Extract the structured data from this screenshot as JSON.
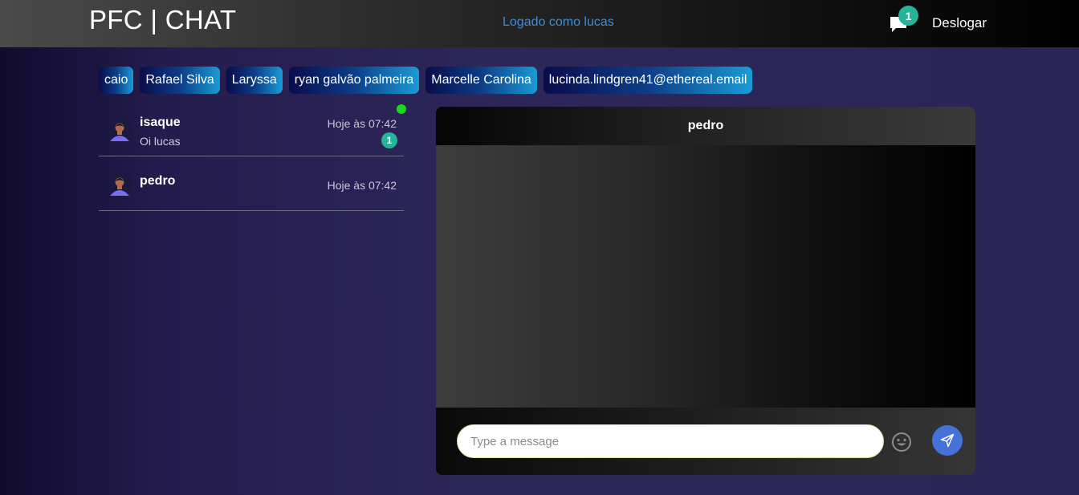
{
  "header": {
    "brand": "PFC | CHAT",
    "logged_in_text": "Logado como lucas",
    "notification_count": "1",
    "logout_label": "Deslogar",
    "chat_icon": "chat-bubble-icon"
  },
  "online_users": [
    {
      "label": "caio"
    },
    {
      "label": "Rafael Silva"
    },
    {
      "label": "Laryssa"
    },
    {
      "label": "ryan galvão palmeira"
    },
    {
      "label": "Marcelle Carolina"
    },
    {
      "label": "lucinda.lindgren41@ethereal.email"
    }
  ],
  "conversations": [
    {
      "name": "isaque",
      "last_message": "Oi lucas",
      "time": "Hoje às 07:42",
      "unread": "1",
      "online": true
    },
    {
      "name": "pedro",
      "last_message": "",
      "time": "Hoje às 07:42",
      "unread": "",
      "online": false
    }
  ],
  "chat": {
    "title": "pedro",
    "input_placeholder": "Type a message",
    "input_value": "",
    "emoji_icon": "smiley-icon",
    "send_icon": "send-icon"
  },
  "colors": {
    "accent_green": "#22b59a",
    "online": "#1ed61e",
    "send_button": "#4472d9",
    "link_blue": "#3d8fd6"
  }
}
